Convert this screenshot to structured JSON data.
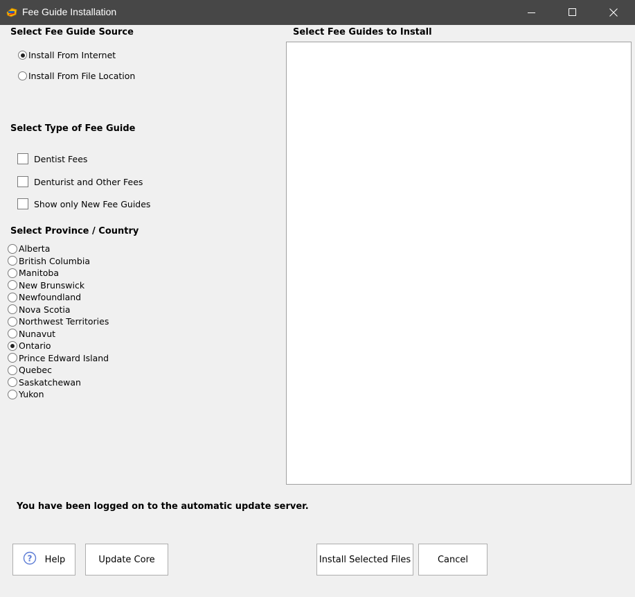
{
  "window": {
    "title": "Fee Guide Installation"
  },
  "source": {
    "heading": "Select Fee Guide Source",
    "options": [
      {
        "label": "Install From Internet",
        "checked": true
      },
      {
        "label": "Install From File Location",
        "checked": false
      }
    ]
  },
  "type": {
    "heading": "Select Type of Fee Guide",
    "options": [
      {
        "label": "Dentist Fees",
        "checked": false
      },
      {
        "label": "Denturist and Other Fees",
        "checked": false
      },
      {
        "label": "Show only New Fee Guides",
        "checked": false
      }
    ]
  },
  "province": {
    "heading": "Select Province / Country",
    "options": [
      {
        "label": "Alberta",
        "checked": false
      },
      {
        "label": "British Columbia",
        "checked": false
      },
      {
        "label": "Manitoba",
        "checked": false
      },
      {
        "label": "New Brunswick",
        "checked": false
      },
      {
        "label": "Newfoundland",
        "checked": false
      },
      {
        "label": "Nova Scotia",
        "checked": false
      },
      {
        "label": "Northwest Territories",
        "checked": false
      },
      {
        "label": "Nunavut",
        "checked": false
      },
      {
        "label": "Ontario",
        "checked": true
      },
      {
        "label": "Prince Edward Island",
        "checked": false
      },
      {
        "label": "Quebec",
        "checked": false
      },
      {
        "label": "Saskatchewan",
        "checked": false
      },
      {
        "label": "Yukon",
        "checked": false
      }
    ]
  },
  "guides": {
    "heading": "Select Fee Guides to Install",
    "items": []
  },
  "status": {
    "message": "You have been logged on to the automatic update server."
  },
  "buttons": {
    "help": "Help",
    "update_core": "Update Core",
    "install": "Install Selected Files",
    "cancel": "Cancel"
  },
  "icons": {
    "app": "fee-guide-app-icon",
    "help": "question-circle-icon",
    "minimize": "minimize-icon",
    "maximize": "maximize-icon",
    "close": "close-icon"
  },
  "colors": {
    "titlebar": "#474747",
    "background": "#f0f0f0",
    "help_icon": "#5b7bd5"
  }
}
